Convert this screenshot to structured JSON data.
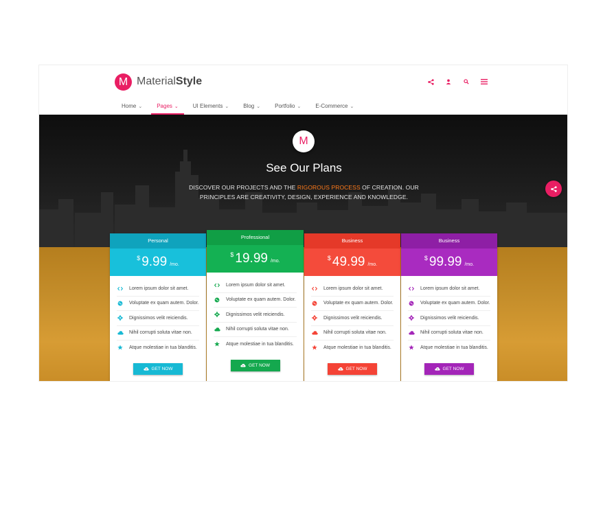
{
  "brand": {
    "logo_letter": "M",
    "name_light": "Material",
    "name_bold": "Style"
  },
  "header_icons": [
    "share-icon",
    "user-icon",
    "search-icon",
    "menu-icon"
  ],
  "nav": [
    {
      "label": "Home",
      "active": false
    },
    {
      "label": "Pages",
      "active": true
    },
    {
      "label": "UI Elements",
      "active": false
    },
    {
      "label": "Blog",
      "active": false
    },
    {
      "label": "Portfolio",
      "active": false
    },
    {
      "label": "E-Commerce",
      "active": false
    }
  ],
  "hero": {
    "logo_letter": "M",
    "title": "See Our Plans",
    "sub_1": "DISCOVER OUR PROJECTS AND THE ",
    "sub_highlight": "RIGOROUS PROCESS",
    "sub_2": " OF CREATION. OUR PRINCIPLES ARE CREATIVITY, DESIGN, EXPERIENCE AND KNOWLEDGE."
  },
  "features": [
    {
      "text": "Lorem ipsum dolor sit amet.",
      "icon": "code-icon"
    },
    {
      "text": "Voluptate ex quam autem. Dolor.",
      "icon": "globe-icon"
    },
    {
      "text": "Dignissimos velit reiciendis.",
      "icon": "gear-icon"
    },
    {
      "text": "Nihil corrupti soluta vitae non.",
      "icon": "cloud-icon"
    },
    {
      "text": "Atque molestiae in tua blanditis.",
      "icon": "star-icon"
    }
  ],
  "plans": [
    {
      "name": "Personal",
      "currency": "$",
      "price": "9.99",
      "period": "/mo.",
      "button": "GET NOW",
      "head_color": "#0fa3bd",
      "price_color": "#18c0db",
      "accent": "#17b9d4"
    },
    {
      "name": "Professional",
      "currency": "$",
      "price": "19.99",
      "period": "/mo.",
      "button": "GET NOW",
      "head_color": "#109e45",
      "price_color": "#14b153",
      "accent": "#14a84e"
    },
    {
      "name": "Business",
      "currency": "$",
      "price": "49.99",
      "period": "/mo.",
      "button": "GET NOW",
      "head_color": "#e53929",
      "price_color": "#f44b3b",
      "accent": "#f44336"
    },
    {
      "name": "Business",
      "currency": "$",
      "price": "99.99",
      "period": "/mo.",
      "button": "GET NOW",
      "head_color": "#8e1fa5",
      "price_color": "#a92bc0",
      "accent": "#a325b8"
    }
  ],
  "colors": {
    "brand": "#e91e63",
    "hero_highlight": "#ff7a1a"
  }
}
